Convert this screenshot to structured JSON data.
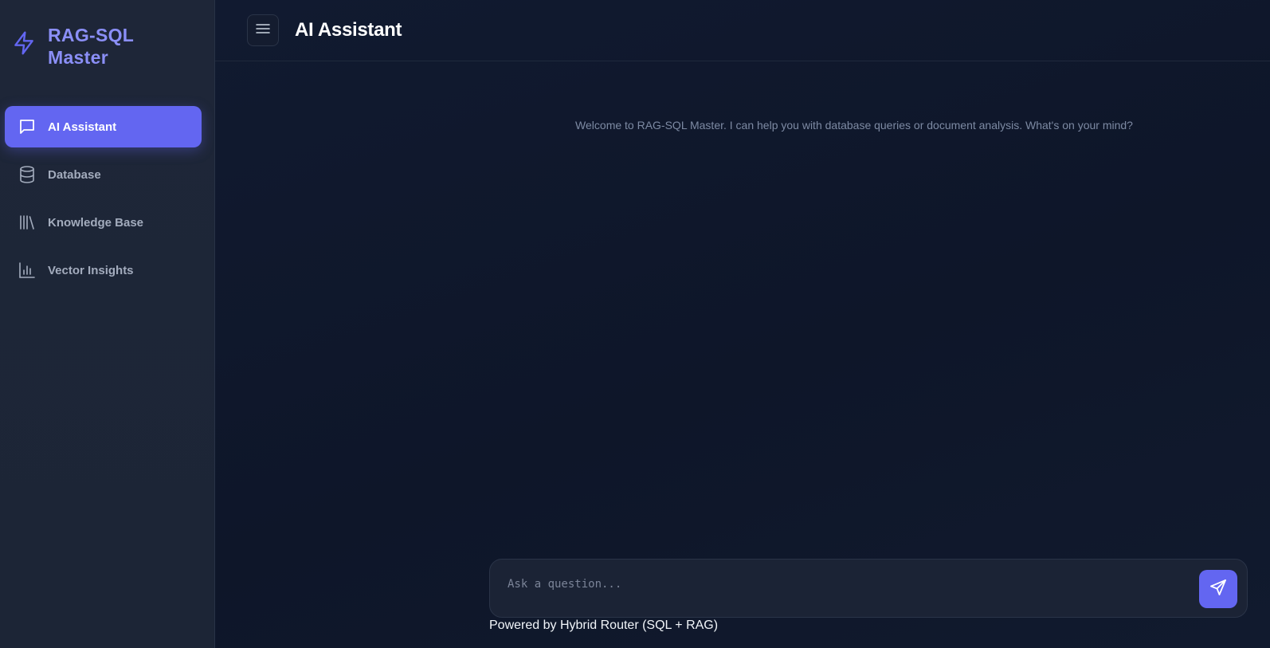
{
  "brand": {
    "title": "RAG-SQL Master",
    "icon": "lightning-icon",
    "accent": "#6366f1"
  },
  "sidebar": {
    "items": [
      {
        "label": "AI Assistant",
        "icon": "message-square-icon",
        "active": true
      },
      {
        "label": "Database",
        "icon": "database-icon",
        "active": false
      },
      {
        "label": "Knowledge Base",
        "icon": "library-icon",
        "active": false
      },
      {
        "label": "Vector Insights",
        "icon": "bar-chart-icon",
        "active": false
      }
    ]
  },
  "header": {
    "title": "AI Assistant",
    "menu_icon": "hamburger-menu-icon"
  },
  "chat": {
    "welcome": "Welcome to RAG-SQL Master. I can help you with database queries or document analysis. What's on your mind?",
    "input_placeholder": "Ask a question...",
    "input_value": "",
    "send_icon": "send-icon",
    "footer": "Powered by Hybrid Router (SQL + RAG)"
  }
}
